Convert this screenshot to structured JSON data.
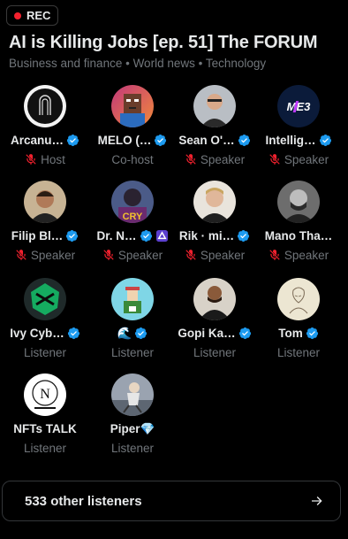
{
  "rec_label": "REC",
  "space": {
    "title": "AI is Killing Jobs [ep. 51] The FORUM",
    "topics": "Business and finance • World news • Technology"
  },
  "participants": [
    {
      "name": "Arcanu…",
      "role": "Host",
      "verified": true,
      "muted": true
    },
    {
      "name": "MELO (…",
      "role": "Co-host",
      "verified": true,
      "muted": false
    },
    {
      "name": "Sean O'…",
      "role": "Speaker",
      "verified": true,
      "muted": true
    },
    {
      "name": "Intellig…",
      "role": "Speaker",
      "verified": true,
      "muted": true
    },
    {
      "name": "Filip Bl…",
      "role": "Speaker",
      "verified": true,
      "muted": true
    },
    {
      "name": "Dr. N…",
      "role": "Speaker",
      "verified": true,
      "muted": true
    },
    {
      "name": "Rik · mi…",
      "role": "Speaker",
      "verified": true,
      "muted": true
    },
    {
      "name": "Mano Tha…",
      "role": "Speaker",
      "verified": false,
      "muted": true
    },
    {
      "name": "Ivy Cyb…",
      "role": "Listener",
      "verified": true,
      "muted": false
    },
    {
      "name": "🌊",
      "role": "Listener",
      "verified": true,
      "muted": false
    },
    {
      "name": "Gopi Ka…",
      "role": "Listener",
      "verified": true,
      "muted": false
    },
    {
      "name": "Tom",
      "role": "Listener",
      "verified": true,
      "muted": false
    },
    {
      "name": "NFTs TALK",
      "role": "Listener",
      "verified": false,
      "muted": false
    },
    {
      "name": "Piper💎",
      "role": "Listener",
      "verified": false,
      "muted": false
    }
  ],
  "icons": {
    "verified": "verified-badge-icon",
    "muted": "mic-off-icon",
    "arrow": "arrow-right-icon"
  },
  "colors": {
    "accent": "#1d9bf0",
    "muted_red": "#f4212e",
    "secondary_text": "#71767b"
  },
  "listeners": {
    "label": "533 other listeners"
  }
}
